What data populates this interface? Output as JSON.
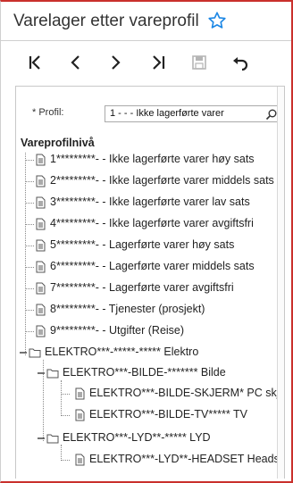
{
  "header": {
    "title": "Varelager etter vareprofil",
    "star_icon": "star-icon"
  },
  "toolbar": {
    "buttons": [
      {
        "name": "first-record-button",
        "icon": "first-icon"
      },
      {
        "name": "previous-record-button",
        "icon": "previous-icon"
      },
      {
        "name": "next-record-button",
        "icon": "next-icon"
      },
      {
        "name": "last-record-button",
        "icon": "last-icon"
      },
      {
        "name": "save-button",
        "icon": "save-icon"
      },
      {
        "name": "undo-button",
        "icon": "undo-icon"
      }
    ]
  },
  "filter": {
    "required_marker": "*",
    "profile_label": "Profil:",
    "profile_value": "1        -    - - Ikke lagerførte varer",
    "search_icon": "search-icon"
  },
  "tree": {
    "title": "Vareprofilnivå",
    "level1": [
      {
        "label": "1*********- - Ikke lagerførte varer høy sats"
      },
      {
        "label": "2*********- - Ikke lagerførte varer middels sats"
      },
      {
        "label": "3*********- - Ikke lagerførte varer lav sats"
      },
      {
        "label": "4*********- - Ikke lagerførte varer avgiftsfri"
      },
      {
        "label": "5*********- - Lagerførte varer høy sats"
      },
      {
        "label": "6*********- - Lagerførte varer middels sats"
      },
      {
        "label": "7*********- - Lagerførte varer avgiftsfri"
      },
      {
        "label": "8*********- - Tjenester (prosjekt)"
      },
      {
        "label": "9*********- - Utgifter (Reise)"
      }
    ],
    "elektro": {
      "label": "ELEKTRO***-*****-***** Elektro",
      "bilde": {
        "label": "ELEKTRO***-BILDE-******* Bilde",
        "children": [
          "ELEKTRO***-BILDE-SKJERM* PC skjerm",
          "ELEKTRO***-BILDE-TV***** TV"
        ]
      },
      "lyd": {
        "label": "ELEKTRO***-LYD**-***** LYD",
        "children": [
          "ELEKTRO***-LYD**-HEADSET Headset"
        ]
      }
    }
  },
  "colors": {
    "accent": "#1e88e5",
    "frame_border": "#c9302c"
  }
}
